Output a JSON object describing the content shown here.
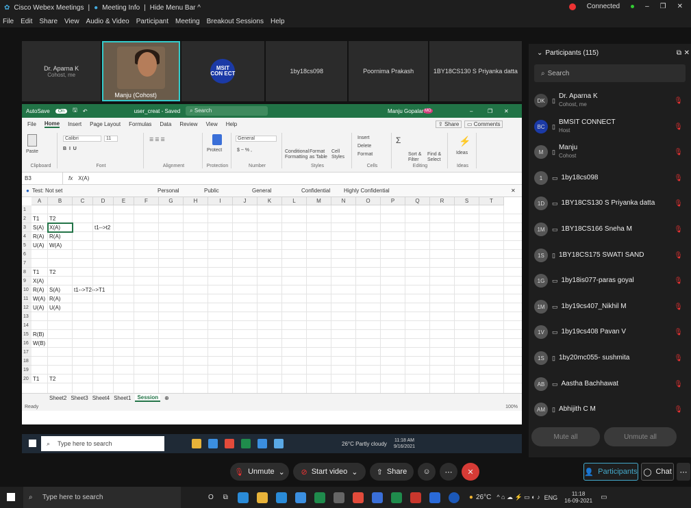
{
  "webex": {
    "app_title": "Cisco Webex Meetings",
    "meeting_info": "Meeting Info",
    "hide_menu": "Hide Menu Bar ^",
    "status": "Connected",
    "menu": [
      "File",
      "Edit",
      "Share",
      "View",
      "Audio & Video",
      "Participant",
      "Meeting",
      "Breakout Sessions",
      "Help"
    ]
  },
  "video_tiles": [
    {
      "name": "Dr. Aparna K",
      "sub": "Cohost, me"
    },
    {
      "name": "Manju  (Cohost)",
      "sub": ""
    },
    {
      "name": "BMSIT CONNECT",
      "sub": ""
    },
    {
      "name": "1by18cs098",
      "sub": ""
    },
    {
      "name": "Poornima Prakash",
      "sub": ""
    },
    {
      "name": "1BY18CS130 S Priyanka datta",
      "sub": ""
    }
  ],
  "logo_text": "MSIT CON ECT",
  "excel": {
    "autosave": "AutoSave",
    "autosave_state": "On",
    "file_name": "user_creat - Saved",
    "search": "Search",
    "user": "Manju Gopalan",
    "user_initials": "MG",
    "share": "Share",
    "comments": "Comments",
    "tabs": [
      "File",
      "Home",
      "Insert",
      "Page Layout",
      "Formulas",
      "Data",
      "Review",
      "View",
      "Help"
    ],
    "ribbon_groups": [
      "Clipboard",
      "Font",
      "Alignment",
      "Protection",
      "Number",
      "Styles",
      "Cells",
      "Editing",
      "Ideas"
    ],
    "ribbon_items": {
      "paste": "Paste",
      "font": "Calibri",
      "size": "11",
      "protect": "Protect",
      "number_format": "General",
      "conditional": "Conditional Formatting",
      "format_table": "Format as Table",
      "cell_styles": "Cell Styles",
      "insert": "Insert",
      "delete": "Delete",
      "format": "Format",
      "sort": "Sort & Filter",
      "find": "Find & Select",
      "ideas": "Ideas"
    },
    "name_box": "B3",
    "fx": "fx",
    "formula_value": "X(A)",
    "sensitivity": {
      "label": "Test: Not set",
      "options": [
        "Personal",
        "Public",
        "General",
        "Confidential",
        "Highly Confidential"
      ]
    },
    "columns": [
      "A",
      "B",
      "C",
      "D",
      "E",
      "F",
      "G",
      "H",
      "I",
      "J",
      "K",
      "L",
      "M",
      "N",
      "O",
      "P",
      "Q",
      "R",
      "S",
      "T"
    ],
    "rows": [
      "1",
      "2",
      "3",
      "4",
      "5",
      "6",
      "7",
      "8",
      "9",
      "10",
      "11",
      "12",
      "13",
      "14",
      "15",
      "16",
      "17",
      "18",
      "19",
      "20"
    ],
    "cells": [
      {
        "r": 1,
        "c": 0,
        "v": "T1"
      },
      {
        "r": 1,
        "c": 1,
        "v": "T2"
      },
      {
        "r": 2,
        "c": 0,
        "v": "S(A)"
      },
      {
        "r": 2,
        "c": 1,
        "v": "X(A)"
      },
      {
        "r": 2,
        "c": 3,
        "v": "t1-->t2"
      },
      {
        "r": 3,
        "c": 0,
        "v": "R(A)"
      },
      {
        "r": 3,
        "c": 1,
        "v": "R(A)"
      },
      {
        "r": 4,
        "c": 0,
        "v": "U(A)"
      },
      {
        "r": 4,
        "c": 1,
        "v": "W(A)"
      },
      {
        "r": 7,
        "c": 0,
        "v": "T1"
      },
      {
        "r": 7,
        "c": 1,
        "v": "T2"
      },
      {
        "r": 8,
        "c": 0,
        "v": "X(A)"
      },
      {
        "r": 9,
        "c": 0,
        "v": "R(A)"
      },
      {
        "r": 9,
        "c": 1,
        "v": "S(A)"
      },
      {
        "r": 9,
        "c": 2,
        "v": "t1-->T2-->T1"
      },
      {
        "r": 10,
        "c": 0,
        "v": "W(A)"
      },
      {
        "r": 10,
        "c": 1,
        "v": "R(A)"
      },
      {
        "r": 11,
        "c": 0,
        "v": "U(A)"
      },
      {
        "r": 11,
        "c": 1,
        "v": "U(A)"
      },
      {
        "r": 14,
        "c": 0,
        "v": "R(B)"
      },
      {
        "r": 15,
        "c": 0,
        "v": "W(B)"
      },
      {
        "r": 19,
        "c": 0,
        "v": "T1"
      },
      {
        "r": 19,
        "c": 1,
        "v": "T2"
      }
    ],
    "sheets": [
      "Sheet2",
      "Sheet3",
      "Sheet4",
      "Sheet1",
      "Session"
    ],
    "status": "Ready",
    "zoom": "100%"
  },
  "inner_taskbar": {
    "search": "Type here to search",
    "weather": "26°C  Partly cloudy",
    "time": "11:18 AM",
    "date": "9/16/2021"
  },
  "controls": {
    "unmute": "Unmute",
    "start_video": "Start video",
    "share": "Share",
    "participants": "Participants",
    "chat": "Chat"
  },
  "participants_panel": {
    "title": "Participants (115)",
    "search": "Search",
    "mute_all": "Mute all",
    "unmute_all": "Unmute all",
    "list": [
      {
        "initials": "DK",
        "name": "Dr. Aparna K",
        "sub": "Cohost, me",
        "device": "mobile"
      },
      {
        "initials": "BC",
        "name": "BMSIT CONNECT",
        "sub": "Host",
        "device": "mobile"
      },
      {
        "initials": "M",
        "name": "Manju",
        "sub": "Cohost",
        "device": "mobile"
      },
      {
        "initials": "1",
        "name": "1by18cs098",
        "sub": "",
        "device": "desktop"
      },
      {
        "initials": "1D",
        "name": "1BY18CS130 S Priyanka datta",
        "sub": "",
        "device": "desktop"
      },
      {
        "initials": "1M",
        "name": "1BY18CS166 Sneha M",
        "sub": "",
        "device": "desktop"
      },
      {
        "initials": "1S",
        "name": "1BY18CS175 SWATI SAND",
        "sub": "",
        "device": "mobile"
      },
      {
        "initials": "1G",
        "name": "1by18is077-paras goyal",
        "sub": "",
        "device": "desktop"
      },
      {
        "initials": "1M",
        "name": "1by19cs407_Nikhil M",
        "sub": "",
        "device": "desktop"
      },
      {
        "initials": "1V",
        "name": "1by19cs408 Pavan V",
        "sub": "",
        "device": "desktop"
      },
      {
        "initials": "1S",
        "name": "1by20mc055- sushmita",
        "sub": "",
        "device": "mobile"
      },
      {
        "initials": "AB",
        "name": "Aastha Bachhawat",
        "sub": "",
        "device": "desktop"
      },
      {
        "initials": "AM",
        "name": "Abhijith C M",
        "sub": "",
        "device": "mobile"
      }
    ]
  },
  "taskbar": {
    "search": "Type here to search",
    "weather": "26°C",
    "lang": "ENG",
    "time": "11:18",
    "date": "16-09-2021"
  }
}
